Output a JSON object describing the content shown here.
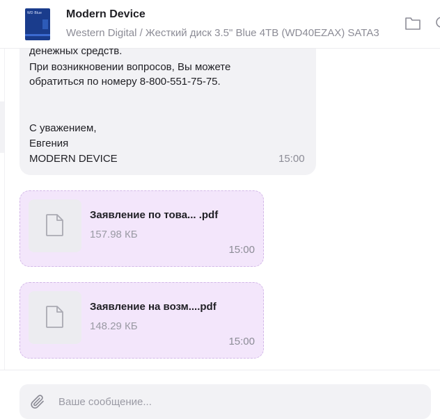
{
  "header": {
    "title": "Modern Device",
    "subtitle": "Western Digital / Жесткий диск 3.5\" Blue 4TB (WD40EZAX) SATA3",
    "product_image_brand": "WD Blue",
    "icons": [
      "folder-icon",
      "search-icon"
    ]
  },
  "messages": {
    "text_message": {
      "lines": [
        "денежных средств.",
        "При возникновении вопросов, Вы можете",
        "обратиться по номеру 8-800-551-75-75.",
        "",
        "",
        "С уважением,",
        "Евгения",
        "MODERN DEVICE"
      ],
      "time": "15:00"
    },
    "files": [
      {
        "name": "Заявление по това... .pdf",
        "size": "157.98 КБ",
        "time": "15:00",
        "icon": "document-icon"
      },
      {
        "name": "Заявление на возм....pdf",
        "size": "148.29 КБ",
        "time": "15:00",
        "icon": "document-icon"
      }
    ]
  },
  "composer": {
    "placeholder": "Ваше сообщение...",
    "value": "",
    "attach_icon": "paperclip-icon"
  },
  "colors": {
    "file_bubble_bg": "#f3e6fb",
    "file_bubble_border": "#d3b8e8",
    "text_bubble_bg": "#f2f2f5",
    "muted_text": "#8c8c96",
    "product_blue": "#1a3c8c"
  }
}
